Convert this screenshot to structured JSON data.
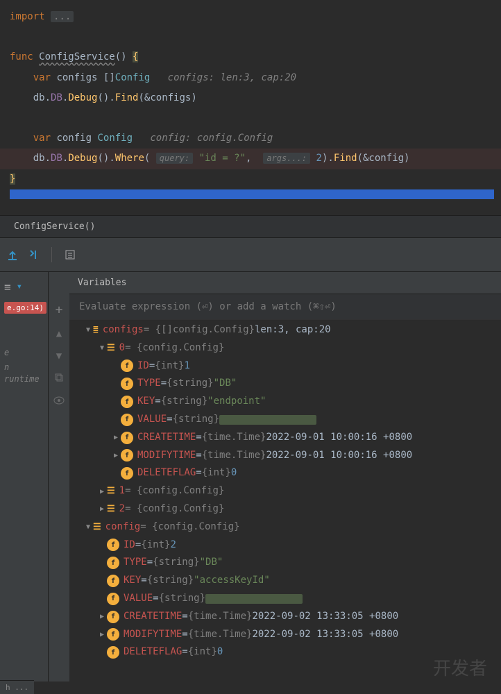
{
  "editor": {
    "line1": {
      "import": "import",
      "dots": "..."
    },
    "line3": {
      "func": "func",
      "name": "ConfigService",
      "parens": "()",
      "brace": "{"
    },
    "line4": {
      "var": "var",
      "configs": "configs",
      "slice": "[]",
      "type": "Config",
      "hint": "configs: len:3, cap:20"
    },
    "line5": {
      "db": "db",
      "DB": "DB",
      "Debug": "Debug",
      "paren1": "().",
      "Find": "Find",
      "rest": "(&configs)"
    },
    "line7": {
      "var": "var",
      "config": "config",
      "type": "Config",
      "hint": "config: config.Config"
    },
    "line8": {
      "db": "db",
      "DB": "DB",
      "Debug": "Debug",
      "paren1": "().",
      "Where": "Where",
      "open": "( ",
      "qhint": "query:",
      "qval": "\"id = ?\"",
      "comma": ",  ",
      "ahint": "args...:",
      "aval": "2",
      "close": ").",
      "Find": "Find",
      "rest": "(&config)"
    },
    "line9": {
      "brace": "}"
    }
  },
  "breadcrumb": {
    "text": "ConfigService()"
  },
  "eval": {
    "placeholder": "Evaluate expression (⏎) or add a watch (⌘⇧⏎)"
  },
  "vars_header": "Variables",
  "file_badge": "e.go:14)",
  "frame_text1": "e",
  "frame_text2": "n runtime",
  "status": "h ...",
  "watermark": "开发者",
  "tree": {
    "configs": {
      "name": "configs",
      "type": " = {[]config.Config} ",
      "meta": "len:3, cap:20"
    },
    "idx0": {
      "name": "0",
      "type": " = {config.Config}"
    },
    "id0": {
      "name": "ID",
      "eq": " = ",
      "type": "{int} ",
      "val": "1"
    },
    "type0": {
      "name": "TYPE",
      "eq": " = ",
      "type": "{string} ",
      "val": "\"DB\""
    },
    "key0": {
      "name": "KEY",
      "eq": " = ",
      "type": "{string} ",
      "val": "\"endpoint\""
    },
    "value0": {
      "name": "VALUE",
      "eq": " = ",
      "type": "{string} "
    },
    "ct0": {
      "name": "CREATETIME",
      "eq": " = ",
      "type": "{time.Time} ",
      "val": "2022-09-01 10:00:16 +0800"
    },
    "mt0": {
      "name": "MODIFYTIME",
      "eq": " = ",
      "type": "{time.Time} ",
      "val": "2022-09-01 10:00:16 +0800"
    },
    "df0": {
      "name": "DELETEFLAG",
      "eq": " = ",
      "type": "{int} ",
      "val": "0"
    },
    "idx1": {
      "name": "1",
      "type": " = {config.Config}"
    },
    "idx2": {
      "name": "2",
      "type": " = {config.Config}"
    },
    "config": {
      "name": "config",
      "type": " = {config.Config}"
    },
    "id1": {
      "name": "ID",
      "eq": " = ",
      "type": "{int} ",
      "val": "2"
    },
    "type1": {
      "name": "TYPE",
      "eq": " = ",
      "type": "{string} ",
      "val": "\"DB\""
    },
    "key1": {
      "name": "KEY",
      "eq": " = ",
      "type": "{string} ",
      "val": "\"accessKeyId\""
    },
    "value1": {
      "name": "VALUE",
      "eq": " = ",
      "type": "{string} "
    },
    "ct1": {
      "name": "CREATETIME",
      "eq": " = ",
      "type": "{time.Time} ",
      "val": "2022-09-02 13:33:05 +0800"
    },
    "mt1": {
      "name": "MODIFYTIME",
      "eq": " = ",
      "type": "{time.Time} ",
      "val": "2022-09-02 13:33:05 +0800"
    },
    "df1": {
      "name": "DELETEFLAG",
      "eq": " = ",
      "type": "{int} ",
      "val": "0"
    }
  }
}
